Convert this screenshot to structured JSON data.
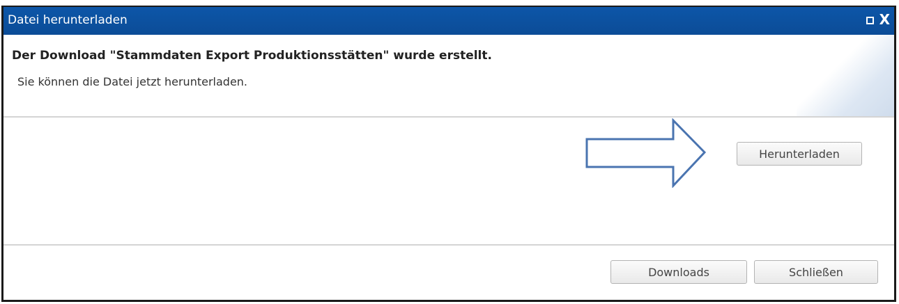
{
  "window": {
    "title": "Datei herunterladen"
  },
  "header": {
    "headline": "Der Download \"Stammdaten Export Produktionsstätten\" wurde erstellt.",
    "subline": "Sie können die Datei jetzt herunterladen."
  },
  "body": {
    "download_button": "Herunterladen"
  },
  "footer": {
    "downloads_button": "Downloads",
    "close_button": "Schließen"
  },
  "colors": {
    "titlebar": "#0d56a8",
    "arrow_stroke": "#4a74b0",
    "text": "#222222"
  },
  "icons": {
    "maximize": "maximize-icon",
    "close": "close-icon",
    "annotation": "arrow-right-icon"
  }
}
